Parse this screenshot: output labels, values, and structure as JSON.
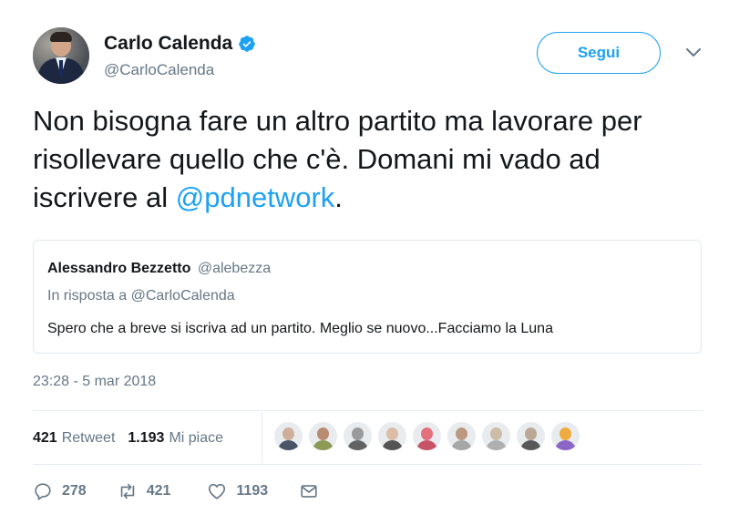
{
  "user": {
    "name": "Carlo Calenda",
    "handle": "@CarloCalenda",
    "avatar_icon": "profile-photo"
  },
  "follow_button": {
    "label": "Segui"
  },
  "menu_icon": "chevron-down-icon",
  "tweet": {
    "text_before": "Non bisogna fare un altro partito ma lavorare per risollevare quello che c'è. Domani mi vado ad iscrivere al ",
    "mention": "@pdnetwork",
    "text_after": "."
  },
  "quoted_tweet": {
    "author_name": "Alessandro Bezzetto",
    "author_handle": "@alebezza",
    "reply_to": "In risposta a @CarloCalenda",
    "text": "Spero che a breve si iscriva ad un partito. Meglio se nuovo...Facciamo la Luna"
  },
  "timestamp": "23:28 - 5 mar 2018",
  "stats": {
    "retweets_count": "421",
    "retweets_label": "Retweet",
    "likes_count": "1.193",
    "likes_label": "Mi piace"
  },
  "likers": [
    {
      "face": "#c9a48c",
      "body": "#2d3a4f"
    },
    {
      "face": "#b07a5a",
      "body": "#7a8c3a"
    },
    {
      "face": "#8c8c8c",
      "body": "#4a4a4a"
    },
    {
      "face": "#d8b49a",
      "body": "#3a3a3a"
    },
    {
      "face": "#e35a6a",
      "body": "#c0394d"
    },
    {
      "face": "#b58a6c",
      "body": "#9a9a9a"
    },
    {
      "face": "#c8b49a",
      "body": "#a5a5a5"
    },
    {
      "face": "#b29b86",
      "body": "#3f3f3f"
    },
    {
      "face": "#f0a020",
      "body": "#7a4fc0"
    }
  ],
  "actions": {
    "reply_count": "278",
    "retweet_count": "421",
    "like_count": "1193"
  },
  "colors": {
    "accent": "#1da1f2",
    "secondary_text": "#657786",
    "border": "#e1e8ed"
  }
}
